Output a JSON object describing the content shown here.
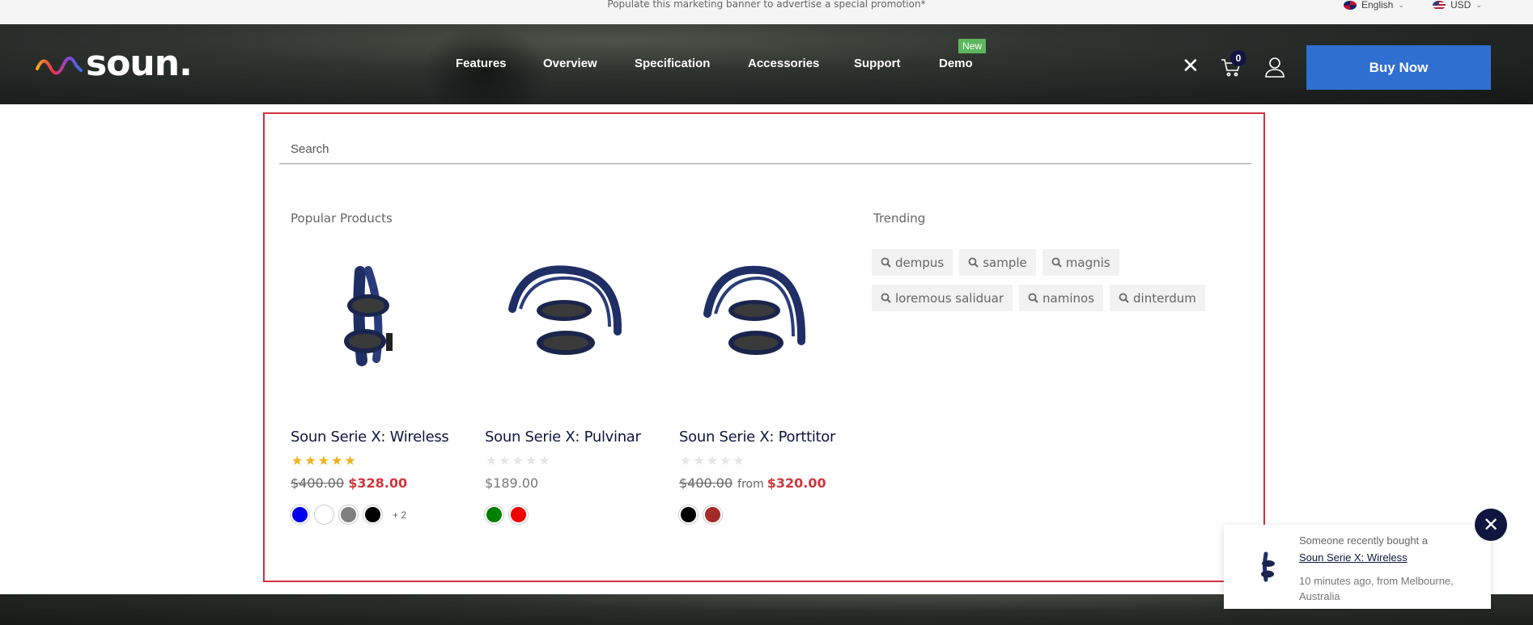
{
  "topbar": {
    "promo_text": "Populate this marketing banner to advertise a special promotion*",
    "language": "English",
    "currency": "USD"
  },
  "header": {
    "logo_text": "soun.",
    "nav": [
      "Features",
      "Overview",
      "Specification",
      "Accessories",
      "Support",
      "Demo"
    ],
    "demo_badge": "New",
    "cart_count": "0",
    "buy_now_label": "Buy Now"
  },
  "search": {
    "placeholder": "Search",
    "popular_title": "Popular Products",
    "trending_title": "Trending",
    "products": [
      {
        "name": "Soun Serie X: Wireless",
        "rating": 5,
        "stars": "★★★★★",
        "old_price": "$400.00",
        "price": "$328.00",
        "colors": [
          "#0000ee",
          "#ffffff",
          "#808080",
          "#000000"
        ],
        "more_colors": "+ 2"
      },
      {
        "name": "Soun Serie X: Pulvinar",
        "rating": 0,
        "stars": "★★★★★",
        "price": "$189.00",
        "colors": [
          "#008000",
          "#ee0000"
        ]
      },
      {
        "name": "Soun Serie X: Porttitor",
        "rating": 0,
        "stars": "★★★★★",
        "old_price": "$400.00",
        "from_label": "from",
        "price": "$320.00",
        "colors": [
          "#000000",
          "#a52a2a"
        ]
      }
    ],
    "trending": [
      "dempus",
      "sample",
      "magnis",
      "loremous saliduar",
      "naminos",
      "dinterdum"
    ]
  },
  "notification": {
    "line1": "Someone recently bought a",
    "product": "Soun Serie X: Wireless",
    "line3": "10 minutes ago, from Melbourne, Australia"
  },
  "colors": {
    "accent": "#2f6fd0",
    "navy": "#10163f",
    "sale": "#d0373f",
    "panel_border": "#d32f3f",
    "star": "#f2b01e"
  }
}
